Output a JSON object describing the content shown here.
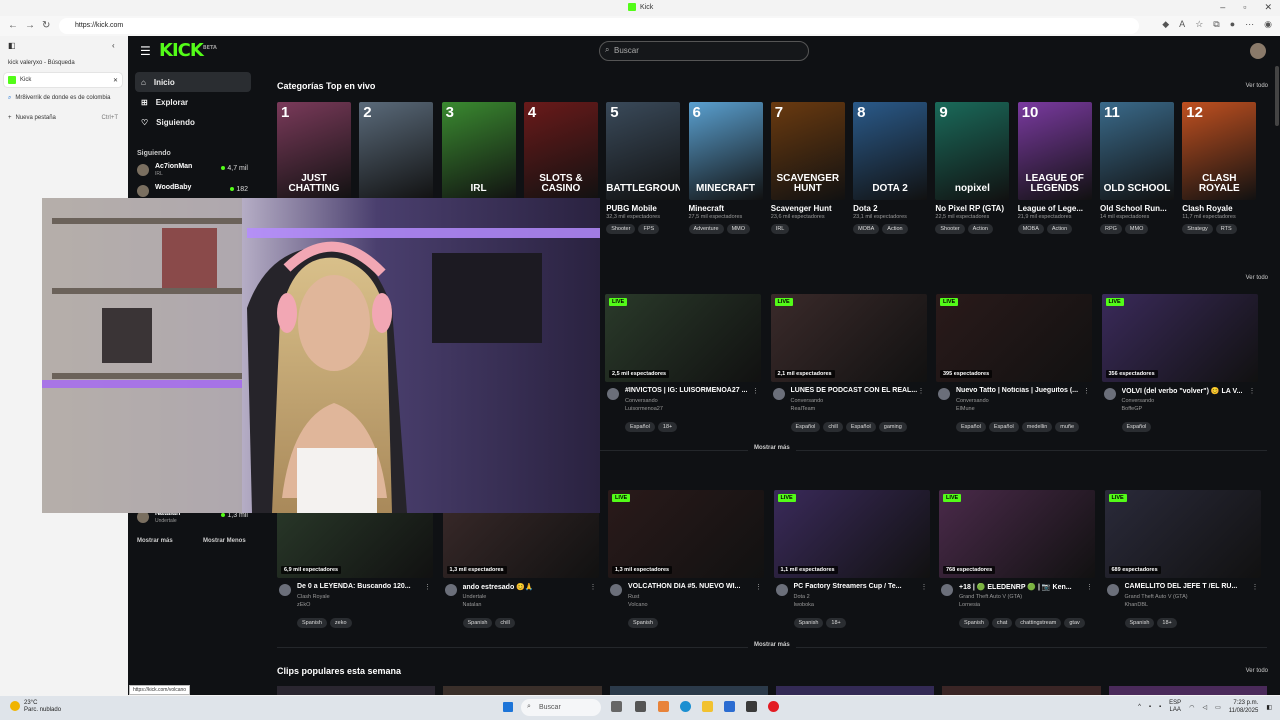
{
  "browser": {
    "window_title": "Kick",
    "url": "https://kick.com",
    "tabs": [
      {
        "label": "kick valeryxo - Búsqueda"
      },
      {
        "label": "Kick"
      },
      {
        "label": "Mr8iverrik de donde es de colombia"
      }
    ],
    "new_tab": "Nueva pestaña",
    "new_tab_shortcut": "Ctrl+T",
    "status_url": "https://kick.com/volcano"
  },
  "kick": {
    "search_placeholder": "Buscar",
    "nav": [
      {
        "label": "Inicio"
      },
      {
        "label": "Explorar"
      },
      {
        "label": "Siguiendo"
      }
    ],
    "following_title": "Siguiendo",
    "following": [
      {
        "name": "Ac7ionMan",
        "game": "IRL",
        "viewers": "4,7 mil"
      },
      {
        "name": "WoodBaby",
        "game": "",
        "viewers": "182"
      },
      {
        "name": "Natalan",
        "game": "Undertale",
        "viewers": "1,3 mil"
      }
    ],
    "show_more": "Mostrar más",
    "show_less": "Mostrar Menos",
    "top_categories_title": "Categorías Top en vivo",
    "see_all": "Ver todo",
    "categories": [
      {
        "rank": "1",
        "caption": "JUST CHATTING",
        "name": "",
        "viewers": "",
        "tags": []
      },
      {
        "rank": "2",
        "caption": "",
        "name": "",
        "viewers": "",
        "tags": []
      },
      {
        "rank": "3",
        "caption": "IRL",
        "name": "",
        "viewers": "",
        "tags": []
      },
      {
        "rank": "4",
        "caption": "SLOTS & CASINO",
        "name": "",
        "viewers": "",
        "tags": []
      },
      {
        "rank": "5",
        "caption": "BATTLEGROUNDS",
        "name": "PUBG Mobile",
        "viewers": "32,3 mil espectadores",
        "tags": [
          "Shooter",
          "FPS"
        ]
      },
      {
        "rank": "6",
        "caption": "MINECRAFT",
        "name": "Minecraft",
        "viewers": "27,5 mil espectadores",
        "tags": [
          "Adventure",
          "MMO"
        ]
      },
      {
        "rank": "7",
        "caption": "SCAVENGER HUNT",
        "name": "Scavenger Hunt",
        "viewers": "23,6 mil espectadores",
        "tags": [
          "IRL"
        ]
      },
      {
        "rank": "8",
        "caption": "DOTA 2",
        "name": "Dota 2",
        "viewers": "23,1 mil espectadores",
        "tags": [
          "MOBA",
          "Action"
        ]
      },
      {
        "rank": "9",
        "caption": "nopixel",
        "name": "No Pixel RP (GTA)",
        "viewers": "22,5 mil espectadores",
        "tags": [
          "Shooter",
          "Action"
        ]
      },
      {
        "rank": "10",
        "caption": "LEAGUE OF LEGENDS",
        "name": "League of Lege...",
        "viewers": "21,9 mil espectadores",
        "tags": [
          "MOBA",
          "Action"
        ]
      },
      {
        "rank": "11",
        "caption": "OLD SCHOOL",
        "name": "Old School Run...",
        "viewers": "14 mil espectadores",
        "tags": [
          "RPG",
          "MMO"
        ]
      },
      {
        "rank": "12",
        "caption": "CLASH ROYALE",
        "name": "Clash Royale",
        "viewers": "11,7 mil espectadores",
        "tags": [
          "Strategy",
          "RTS"
        ]
      }
    ],
    "streams_row1": [
      {
        "viewers": "2,5 mil espectadores",
        "title": "#INVICTOS | IG: LUISORMENOA27 ...",
        "category": "Conversando",
        "channel": "Luisormenoa27",
        "tags": [
          "Español",
          "18+"
        ]
      },
      {
        "viewers": "2,1 mil espectadores",
        "title": "LUNES DE PODCAST CON EL REAL...",
        "category": "Conversando",
        "channel": "RealTeam",
        "tags": [
          "Español",
          "chill",
          "Español",
          "gaming"
        ]
      },
      {
        "viewers": "395 espectadores",
        "title": "Nuevo Tatto | Noticias | Jueguitos (...",
        "category": "Conversando",
        "channel": "ElMune",
        "tags": [
          "Español",
          "Español",
          "medellin",
          "muñe"
        ]
      },
      {
        "viewers": "356 espectadores",
        "title": "VOLVI (del verbo \"volver\") 😊 LA V...",
        "category": "Conversando",
        "channel": "BoffeGP",
        "tags": [
          "Español"
        ]
      }
    ],
    "streams_row2": [
      {
        "viewers": "6,9 mil espectadores",
        "title": "De 0 a LEYENDA: Buscando 120...",
        "category": "Clash Royale",
        "channel": "zEkO",
        "tags": [
          "Spanish",
          "zeko"
        ]
      },
      {
        "viewers": "1,3 mil espectadores",
        "title": "ando estresado 😊🙏",
        "category": "Undertale",
        "channel": "Natalan",
        "tags": [
          "Spanish",
          "chill"
        ]
      },
      {
        "viewers": "1,3 mil espectadores",
        "title": "VOLCATHON DÍA #5. NUEVO WI...",
        "category": "Rust",
        "channel": "Volcano",
        "tags": [
          "Spanish"
        ]
      },
      {
        "viewers": "1,1 mil espectadores",
        "title": "PC Factory Streamers Cup / Te...",
        "category": "Dota 2",
        "channel": "Iwoboka",
        "tags": [
          "Spanish",
          "18+"
        ]
      },
      {
        "viewers": "768 espectadores",
        "title": "+18 | 🟢 ELEDENRP 🟢 | 📷 Ken...",
        "category": "Grand Theft Auto V (GTA)",
        "channel": "Lornesia",
        "tags": [
          "Spanish",
          "chat",
          "chattingstream",
          "gtav"
        ]
      },
      {
        "viewers": "689 espectadores",
        "title": "CAMELLITO DEL JEFE T /EL RU...",
        "category": "Grand Theft Auto V (GTA)",
        "channel": "KhanDBL",
        "tags": [
          "Spanish",
          "18+"
        ]
      }
    ],
    "live_badge": "LIVE",
    "show_more_center": "Mostrar más",
    "clips_title": "Clips populares esta semana",
    "accent": "#53fc18"
  },
  "taskbar": {
    "temp": "23°C",
    "weather": "Parc. nublado",
    "search_placeholder": "Buscar",
    "lang": "ESP",
    "lang2": "LAA",
    "time": "7:23 p.m.",
    "date": "11/08/2025"
  },
  "icons": [
    "back-icon",
    "forward-icon",
    "refresh-icon",
    "menu-icon",
    "search-icon",
    "home-icon",
    "compass-icon",
    "heart-icon",
    "more-icon",
    "windows-icon",
    "wifi-icon",
    "volume-icon"
  ]
}
